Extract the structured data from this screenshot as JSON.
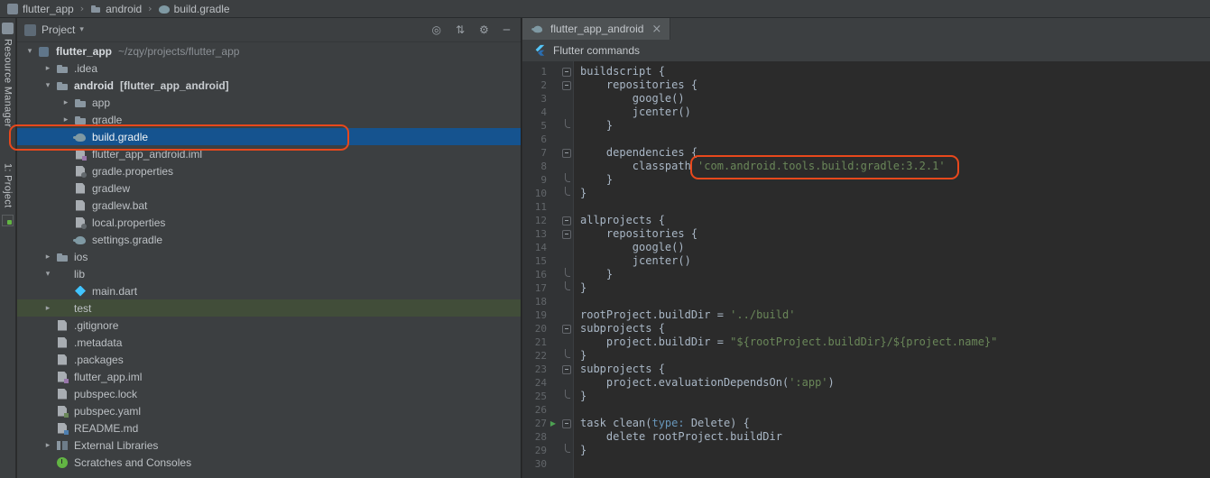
{
  "colors": {
    "annotation_red": "#e8481c",
    "selection_blue": "#15538f",
    "test_row_green": "#414d39",
    "string_green": "#6a8759",
    "editor_bg": "#2b2b2b",
    "panel_bg": "#3c3f41"
  },
  "icons": {
    "chevron-down": "▾",
    "chevron-right": "▸",
    "dropdown": "▾",
    "separator": "›",
    "locate": "◎",
    "collapse": "⇅",
    "gear": "⚙",
    "hide": "─",
    "close": "×",
    "run": "▶"
  },
  "breadcrumb": {
    "items": [
      {
        "label": "flutter_app",
        "icon": "app"
      },
      {
        "label": "android",
        "icon": "folder"
      },
      {
        "label": "build.gradle",
        "icon": "gradle"
      }
    ]
  },
  "tool_stripe": {
    "top_label": "Resource Manager",
    "bottom_label": "1: Project"
  },
  "project_panel": {
    "header": {
      "title": "Project"
    },
    "tree": [
      {
        "label": "flutter_app",
        "suffix": "~/zqy/projects/flutter_app",
        "suffix_style": "path",
        "indent": 0,
        "arrow": "down",
        "icon": "flutter-project",
        "bold": true
      },
      {
        "label": ".idea",
        "indent": 1,
        "arrow": "right",
        "icon": "folder"
      },
      {
        "label": "android",
        "suffix": "[flutter_app_android]",
        "suffix_style": "module",
        "indent": 1,
        "arrow": "down",
        "icon": "folder",
        "bold": true
      },
      {
        "label": "app",
        "indent": 2,
        "arrow": "right",
        "icon": "folder"
      },
      {
        "label": "gradle",
        "indent": 2,
        "arrow": "right",
        "icon": "folder"
      },
      {
        "label": "build.gradle",
        "indent": 2,
        "arrow": "none",
        "icon": "gradle",
        "selected": true,
        "annotated": true
      },
      {
        "label": "flutter_app_android.iml",
        "indent": 2,
        "arrow": "none",
        "icon": "file-iml"
      },
      {
        "label": "gradle.properties",
        "indent": 2,
        "arrow": "none",
        "icon": "file-prop"
      },
      {
        "label": "gradlew",
        "indent": 2,
        "arrow": "none",
        "icon": "file"
      },
      {
        "label": "gradlew.bat",
        "indent": 2,
        "arrow": "none",
        "icon": "file"
      },
      {
        "label": "local.properties",
        "indent": 2,
        "arrow": "none",
        "icon": "file-prop"
      },
      {
        "label": "settings.gradle",
        "indent": 2,
        "arrow": "none",
        "icon": "gradle"
      },
      {
        "label": "ios",
        "indent": 1,
        "arrow": "right",
        "icon": "folder"
      },
      {
        "label": "lib",
        "indent": 1,
        "arrow": "down",
        "icon": "folder-blue"
      },
      {
        "label": "main.dart",
        "indent": 2,
        "arrow": "none",
        "icon": "dart"
      },
      {
        "label": "test",
        "indent": 1,
        "arrow": "right",
        "icon": "folder-green",
        "highlight": "green"
      },
      {
        "label": ".gitignore",
        "indent": 1,
        "arrow": "none",
        "icon": "file"
      },
      {
        "label": ".metadata",
        "indent": 1,
        "arrow": "none",
        "icon": "file"
      },
      {
        "label": ".packages",
        "indent": 1,
        "arrow": "none",
        "icon": "file"
      },
      {
        "label": "flutter_app.iml",
        "indent": 1,
        "arrow": "none",
        "icon": "file-iml"
      },
      {
        "label": "pubspec.lock",
        "indent": 1,
        "arrow": "none",
        "icon": "file"
      },
      {
        "label": "pubspec.yaml",
        "indent": 1,
        "arrow": "none",
        "icon": "file-yaml"
      },
      {
        "label": "README.md",
        "indent": 1,
        "arrow": "none",
        "icon": "file-md"
      },
      {
        "label": "External Libraries",
        "indent": 1,
        "arrow": "right",
        "icon": "libraries"
      },
      {
        "label": "Scratches and Consoles",
        "indent": 1,
        "arrow": "none",
        "icon": "scratches"
      }
    ]
  },
  "editor": {
    "tab": {
      "label": "flutter_app_android"
    },
    "toolbar": {
      "label": "Flutter commands"
    },
    "code": {
      "lines": [
        {
          "n": 1,
          "fold": "open",
          "segs": [
            {
              "t": "buildscript {"
            }
          ]
        },
        {
          "n": 2,
          "fold": "open",
          "segs": [
            {
              "t": "    repositories {"
            }
          ]
        },
        {
          "n": 3,
          "segs": [
            {
              "t": "        google()"
            }
          ]
        },
        {
          "n": 4,
          "segs": [
            {
              "t": "        jcenter()"
            }
          ]
        },
        {
          "n": 5,
          "fold": "end",
          "segs": [
            {
              "t": "    }"
            }
          ]
        },
        {
          "n": 6,
          "segs": []
        },
        {
          "n": 7,
          "fold": "open",
          "segs": [
            {
              "t": "    dependencies {"
            }
          ]
        },
        {
          "n": 8,
          "segs": [
            {
              "t": "        classpath "
            },
            {
              "t": "'com.android.tools.build:gradle:3.2.1'",
              "c": "str"
            }
          ]
        },
        {
          "n": 9,
          "fold": "end",
          "segs": [
            {
              "t": "    }"
            }
          ]
        },
        {
          "n": 10,
          "fold": "end",
          "segs": [
            {
              "t": "}"
            }
          ]
        },
        {
          "n": 11,
          "segs": []
        },
        {
          "n": 12,
          "fold": "open",
          "segs": [
            {
              "t": "allprojects {"
            }
          ]
        },
        {
          "n": 13,
          "fold": "open",
          "segs": [
            {
              "t": "    repositories {"
            }
          ]
        },
        {
          "n": 14,
          "segs": [
            {
              "t": "        google()"
            }
          ]
        },
        {
          "n": 15,
          "segs": [
            {
              "t": "        jcenter()"
            }
          ]
        },
        {
          "n": 16,
          "fold": "end",
          "segs": [
            {
              "t": "    }"
            }
          ]
        },
        {
          "n": 17,
          "fold": "end",
          "segs": [
            {
              "t": "}"
            }
          ]
        },
        {
          "n": 18,
          "segs": []
        },
        {
          "n": 19,
          "segs": [
            {
              "t": "rootProject.buildDir = "
            },
            {
              "t": "'../build'",
              "c": "str"
            }
          ]
        },
        {
          "n": 20,
          "fold": "open",
          "segs": [
            {
              "t": "subprojects {"
            }
          ]
        },
        {
          "n": 21,
          "segs": [
            {
              "t": "    project.buildDir = "
            },
            {
              "t": "\"${rootProject.buildDir}/${project.name}\"",
              "c": "str"
            }
          ]
        },
        {
          "n": 22,
          "fold": "end",
          "segs": [
            {
              "t": "}"
            }
          ]
        },
        {
          "n": 23,
          "fold": "open",
          "segs": [
            {
              "t": "subprojects {"
            }
          ]
        },
        {
          "n": 24,
          "segs": [
            {
              "t": "    project.evaluationDependsOn("
            },
            {
              "t": "':app'",
              "c": "str"
            },
            {
              "t": ")"
            }
          ]
        },
        {
          "n": 25,
          "fold": "end",
          "segs": [
            {
              "t": "}"
            }
          ]
        },
        {
          "n": 26,
          "segs": []
        },
        {
          "n": 27,
          "fold": "open",
          "run": true,
          "segs": [
            {
              "t": "task clean("
            },
            {
              "t": "type:",
              "c": "param"
            },
            {
              "t": " Delete) {"
            }
          ]
        },
        {
          "n": 28,
          "segs": [
            {
              "t": "    delete rootProject.buildDir"
            }
          ]
        },
        {
          "n": 29,
          "fold": "end",
          "segs": [
            {
              "t": "}"
            }
          ]
        },
        {
          "n": 30,
          "segs": []
        }
      ]
    }
  },
  "annotations": [
    {
      "target": "project-tree-build-gradle-row"
    },
    {
      "target": "code-line-8-classpath-string"
    }
  ]
}
